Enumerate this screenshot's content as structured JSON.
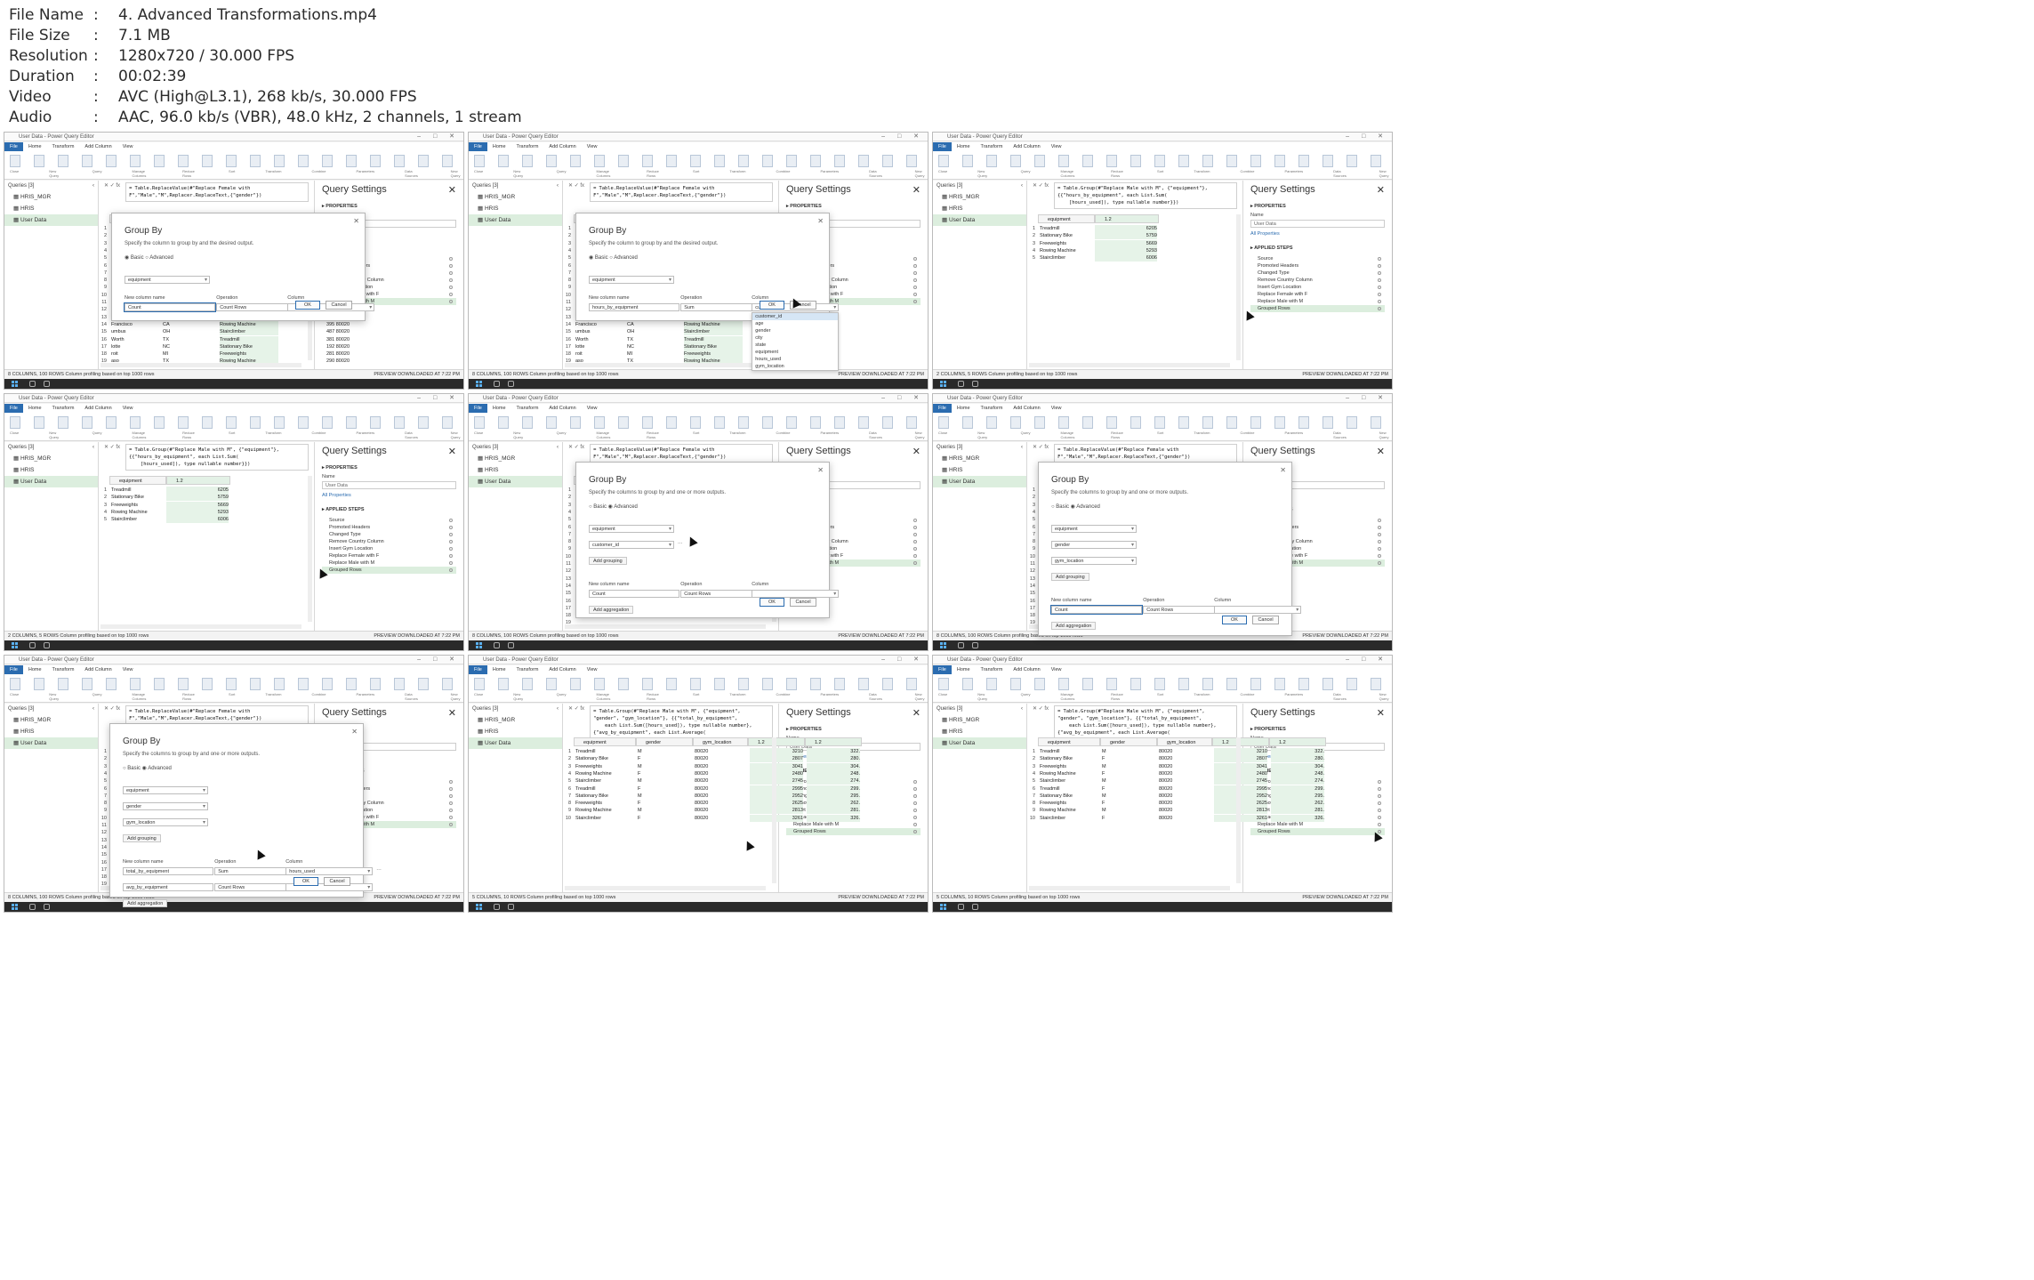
{
  "info": [
    {
      "key": "File Name",
      "value": "4. Advanced Transformations.mp4"
    },
    {
      "key": "File Size",
      "value": "7.1 MB"
    },
    {
      "key": "Resolution",
      "value": "1280x720 / 30.000 FPS"
    },
    {
      "key": "Duration",
      "value": "00:02:39"
    },
    {
      "key": "Video",
      "value": "AVC (High@L3.1), 268 kb/s, 30.000 FPS"
    },
    {
      "key": "Audio",
      "value": "AAC, 96.0 kb/s (VBR), 48.0 kHz, 2 channels, 1 stream"
    }
  ],
  "app": {
    "title": "User Data - Power Query Editor",
    "tabs": [
      "File",
      "Home",
      "Transform",
      "Add Column",
      "View"
    ],
    "ribbon_groups": [
      "Close",
      "New Query",
      "Query",
      "Manage Columns",
      "Reduce Rows",
      "Sort",
      "Transform",
      "Combine",
      "Parameters",
      "Data Sources",
      "New Query"
    ],
    "queries_header": "Queries [3]",
    "queries": [
      "HRIS_MGR",
      "HRIS",
      "User Data"
    ],
    "settings_title": "Query Settings",
    "properties": "PROPERTIES",
    "name_label": "Name",
    "name_value": "User Data",
    "all_properties": "All Properties",
    "applied_steps": "APPLIED STEPS",
    "steps": [
      "Source",
      "Promoted Headers",
      "Changed Type",
      "Remove Country Column",
      "Insert Gym Location",
      "Replace Female with F",
      "Replace Male with M"
    ],
    "grouped_step": "Grouped Rows",
    "preview": "PREVIEW DOWNLOADED AT 7:22 PM",
    "profiling": "Column profiling based on top 1000 rows"
  },
  "formulas": {
    "replace": "= Table.ReplaceValue(#\"Replace Female with F\",\"Male\",\"M\",Replacer.ReplaceText,{\"gender\"})",
    "group_basic": "= Table.Group(#\"Replace Male with M\", {\"equipment\"}, {{\"hours_by_equipment\", each List.Sum(\n    [hours_used]), type nullable number}})",
    "group_adv": "= Table.Group(#\"Replace Male with M\", {\"equipment\", \"gender\", \"gym_location\"}, {{\"total_by_equipment\",\n    each List.Sum([hours_used]), type nullable number}, {\"avg_by_equipment\", each List.Average(\n    [hours_used]), type nullable number}})"
  },
  "raw_table": {
    "header": "city",
    "top_cities": [
      "York",
      "Angeles",
      "ago",
      "ston",
      "enix",
      "adelphia",
      "Antonio",
      "Diego",
      "as",
      "Jose",
      "tin",
      "anapolis"
    ],
    "rows": [
      {
        "n": 13,
        "city": "sonville",
        "state": "FL",
        "equip": "Freeweights",
        "zip": "277 80020"
      },
      {
        "n": 14,
        "city": "Francisco",
        "state": "CA",
        "equip": "Rowing Machine",
        "zip": "395 80020"
      },
      {
        "n": 15,
        "city": "umbus",
        "state": "OH",
        "equip": "Stairclimber",
        "zip": "487 80020"
      },
      {
        "n": 16,
        "city": "Worth",
        "state": "TX",
        "equip": "Treadmill",
        "zip": "381 80020"
      },
      {
        "n": 17,
        "city": "lotte",
        "state": "NC",
        "equip": "Stationary Bike",
        "zip": "192 80020"
      },
      {
        "n": 18,
        "city": "roit",
        "state": "MI",
        "equip": "Freeweights",
        "zip": "281 80020"
      },
      {
        "n": 19,
        "city": "aso",
        "state": "TX",
        "equip": "Rowing Machine",
        "zip": "290 80020"
      }
    ]
  },
  "group_basic_table": {
    "headers": [
      "equipment",
      "1.2  hours_by_equipment"
    ],
    "rows": [
      {
        "n": 1,
        "equipment": "Treadmill",
        "value": "6205"
      },
      {
        "n": 2,
        "equipment": "Stationary Bike",
        "value": "5759"
      },
      {
        "n": 3,
        "equipment": "Freeweights",
        "value": "5669"
      },
      {
        "n": 4,
        "equipment": "Rowing Machine",
        "value": "5293"
      },
      {
        "n": 5,
        "equipment": "Stairclimber",
        "value": "6006"
      }
    ]
  },
  "group_adv_table": {
    "headers": [
      "equipment",
      "gender",
      "gym_location",
      "1.2  total_by_equipment",
      "1.2  avg_by_equipment"
    ],
    "rows": [
      {
        "n": 1,
        "e": "Treadmill",
        "g": "M",
        "l": "80020",
        "t": "3210",
        "a": "322."
      },
      {
        "n": 2,
        "e": "Stationary Bike",
        "g": "F",
        "l": "80020",
        "t": "2807",
        "a": "280."
      },
      {
        "n": 3,
        "e": "Freeweights",
        "g": "M",
        "l": "80020",
        "t": "3041",
        "a": "304."
      },
      {
        "n": 4,
        "e": "Rowing Machine",
        "g": "F",
        "l": "80020",
        "t": "2480",
        "a": "248."
      },
      {
        "n": 5,
        "e": "Stairclimber",
        "g": "M",
        "l": "80020",
        "t": "2745",
        "a": "274."
      },
      {
        "n": 6,
        "e": "Treadmill",
        "g": "F",
        "l": "80020",
        "t": "2995",
        "a": "299."
      },
      {
        "n": 7,
        "e": "Stationary Bike",
        "g": "M",
        "l": "80020",
        "t": "2952",
        "a": "295."
      },
      {
        "n": 8,
        "e": "Freeweights",
        "g": "F",
        "l": "80020",
        "t": "2625",
        "a": "262."
      },
      {
        "n": 9,
        "e": "Rowing Machine",
        "g": "M",
        "l": "80020",
        "t": "2813",
        "a": "281."
      },
      {
        "n": 10,
        "e": "Stairclimber",
        "g": "F",
        "l": "80020",
        "t": "3261",
        "a": "326."
      }
    ]
  },
  "dialog": {
    "title": "Group By",
    "desc_basic": "Specify the column to group by and the desired output.",
    "desc_adv": "Specify the columns to group by and one or more outputs.",
    "basic": "Basic",
    "advanced": "Advanced",
    "new_col": "New column name",
    "operation": "Operation",
    "column": "Column",
    "ok": "OK",
    "cancel": "Cancel",
    "add_grouping": "Add grouping",
    "add_aggregation": "Add aggregation",
    "equipment": "equipment",
    "customer_id": "customer_id",
    "gender": "gender",
    "gym_location": "gym_location",
    "count": "Count",
    "count_rows": "Count Rows",
    "sum": "Sum",
    "hours_by_equipment": "hours_by_equipment",
    "total_by_equipment": "total_by_equipment",
    "avg_by_equipment": "avg_by_equipment",
    "hours_used": "hours_used",
    "column_options": [
      "customer_id",
      "age",
      "gender",
      "city",
      "state",
      "equipment",
      "hours_used",
      "gym_location"
    ]
  },
  "frames": [
    {
      "status": "8 COLUMNS, 100 ROWS"
    },
    {
      "status": "8 COLUMNS, 100 ROWS"
    },
    {
      "status": "2 COLUMNS, 5 ROWS"
    },
    {
      "status": "2 COLUMNS, 5 ROWS"
    },
    {
      "status": "8 COLUMNS, 100 ROWS"
    },
    {
      "status": "8 COLUMNS, 100 ROWS"
    },
    {
      "status": "8 COLUMNS, 100 ROWS"
    },
    {
      "status": "5 COLUMNS, 10 ROWS"
    },
    {
      "status": "5 COLUMNS, 10 ROWS"
    }
  ]
}
